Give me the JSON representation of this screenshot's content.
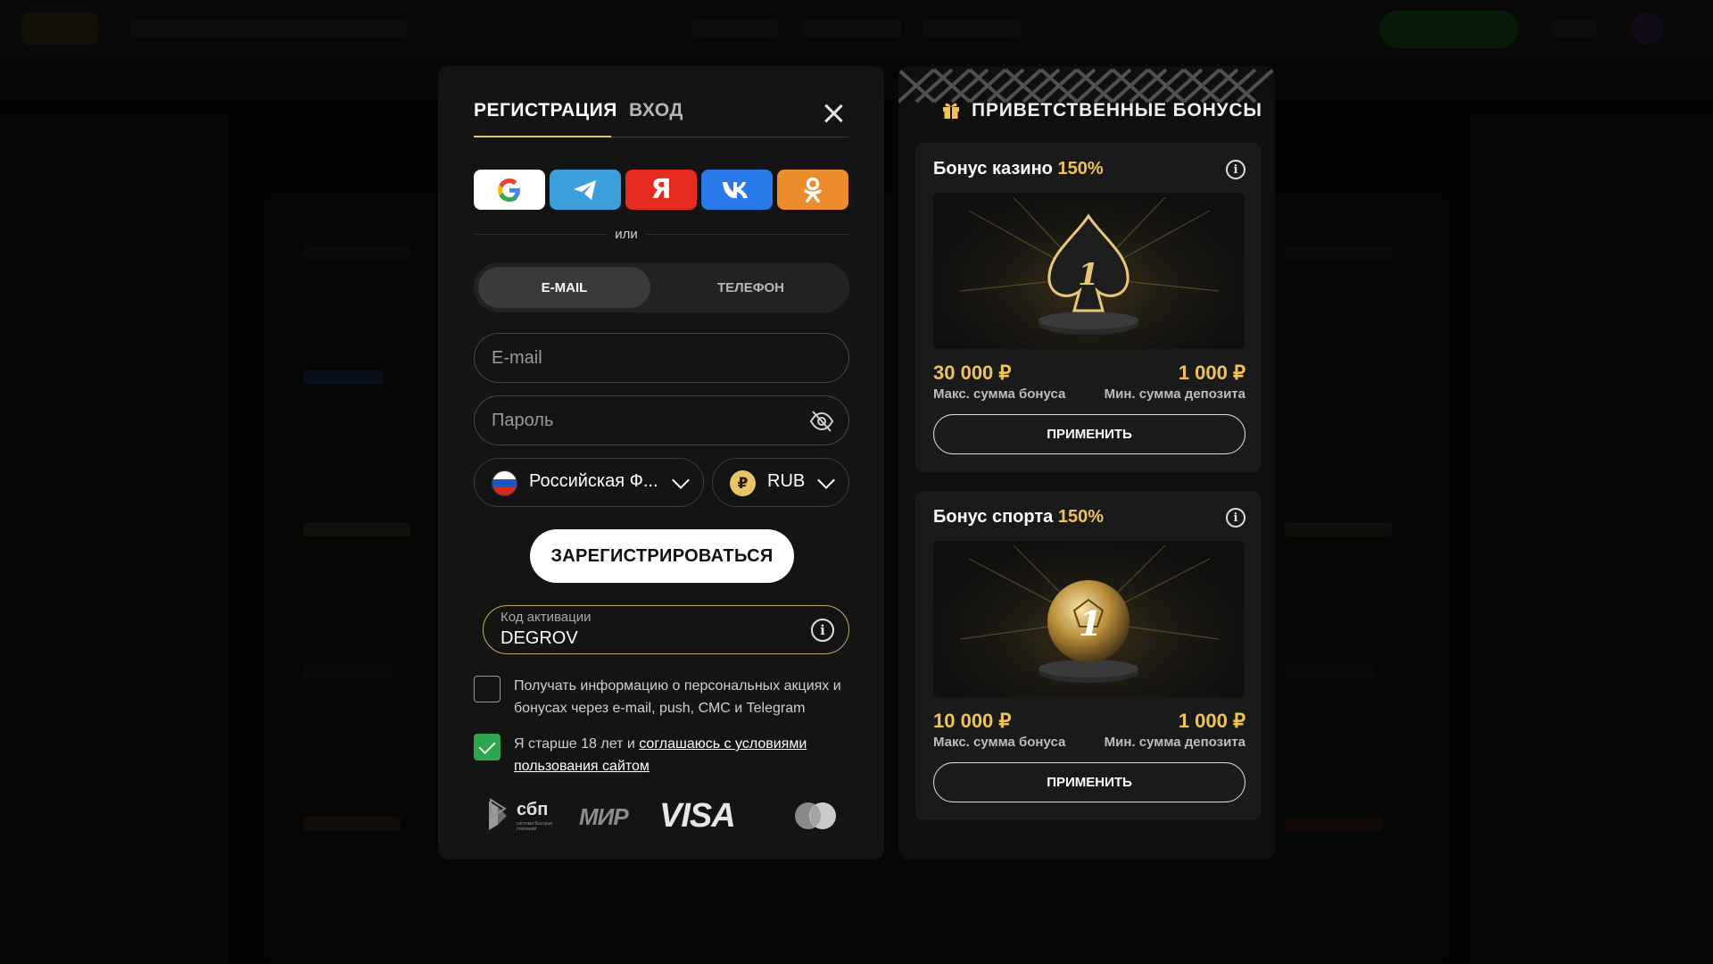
{
  "registration": {
    "tab_register": "РЕГИСТРАЦИЯ",
    "tab_login": "ВХОД",
    "social": [
      "google",
      "telegram",
      "yandex",
      "vk",
      "odnoklassniki"
    ],
    "yandex_glyph": "Я",
    "divider_text": "или",
    "method_email": "E-MAIL",
    "method_phone": "ТЕЛЕФОН",
    "email_placeholder": "E-mail",
    "password_placeholder": "Пароль",
    "country": "Российская Ф...",
    "currency": "RUB",
    "currency_symbol": "₽",
    "register_button": "ЗАРЕГИСТРИРОВАТЬСЯ",
    "promo_label": "Код активации",
    "promo_value": "DEGROV",
    "consent_marketing": "Получать информацию о персональных акциях и бонусах через e-mail, push, СМС и Telegram",
    "consent_marketing_checked": false,
    "consent_age_prefix": "Я старше 18 лет и ",
    "consent_age_link": "соглашаюсь с условиями пользования сайтом",
    "consent_age_checked": true,
    "payments": {
      "sbp": "сбп",
      "sbp_caption": "система быстрых платежей",
      "mir": "МИР",
      "visa": "VISA"
    }
  },
  "bonuses": {
    "header": "ПРИВЕТСТВЕННЫЕ БОНУСЫ",
    "cards": [
      {
        "title": "Бонус казино",
        "percent": "150%",
        "max_amount": "30 000 ₽",
        "max_label": "Макс. сумма бонуса",
        "min_amount": "1 000 ₽",
        "min_label": "Мин. сумма депозита",
        "button": "ПРИМЕНИТЬ",
        "trophy": "spade-trophy",
        "trophy_number": "1"
      },
      {
        "title": "Бонус спорта",
        "percent": "150%",
        "max_amount": "10 000 ₽",
        "max_label": "Макс. сумма бонуса",
        "min_amount": "1 000 ₽",
        "min_label": "Мин. сумма депозита",
        "button": "ПРИМЕНИТЬ",
        "trophy": "ball-trophy",
        "trophy_number": "1"
      }
    ]
  },
  "colors": {
    "accent_gold": "#f0c35a",
    "checkbox_green": "#2da44e",
    "yandex_red": "#e52b1f",
    "telegram_blue": "#3d9fd9",
    "vk_blue": "#2a79e8",
    "ok_orange": "#ec8c2c"
  }
}
